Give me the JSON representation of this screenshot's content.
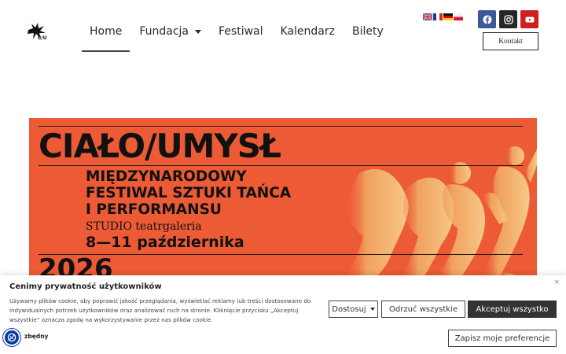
{
  "header": {
    "nav": [
      {
        "label": "Home",
        "active": true
      },
      {
        "label": "Fundacja",
        "dropdown": true
      },
      {
        "label": "Festiwal"
      },
      {
        "label": "Kalendarz"
      },
      {
        "label": "Bilety"
      }
    ],
    "languages": [
      "en-flag-icon",
      "fr-flag-icon",
      "de-flag-icon",
      "pl-flag-icon"
    ],
    "socials": [
      "facebook-icon",
      "instagram-icon",
      "youtube-icon"
    ],
    "contact_label": "Kontakt"
  },
  "banner": {
    "title": "CIAŁO/UMYSŁ",
    "subtitle_line1": "MIĘDZYNARODOWY",
    "subtitle_line2": "FESTIWAL SZTUKI TAŃCA",
    "subtitle_line3": "I PERFORMANSU",
    "venue": "STUDIO teatrgaleria",
    "dates": "8—11 października",
    "year": "2026",
    "background_color": "#ec5a36"
  },
  "cookie": {
    "title": "Cenimy prywatność użytkowników",
    "text": "Używamy plików cookie, aby poprawić jakość przeglądania, wyświetlać reklamy lub treści dostosowane do indywidualnych potrzeb użytkowników oraz analizować ruch na stronie. Kliknięcie przycisku „Akceptuj wszystkie” oznacza zgodę na wykorzystywanie przez nas plików cookie.",
    "customize_label": "Dostosuj",
    "reject_label": "Odrzuć wszystkie",
    "accept_label": "Akceptuj wszystko",
    "save_label": "Zapisz moje preferencje",
    "necessary_label": "zbędny",
    "close_label": "×"
  }
}
